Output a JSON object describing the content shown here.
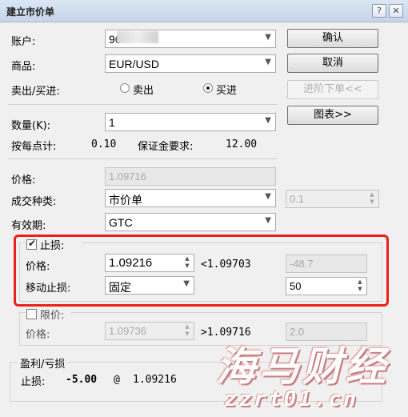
{
  "window": {
    "title": "建立市价单",
    "help": "?",
    "close": "✕"
  },
  "account": {
    "label": "账户:",
    "value": "96"
  },
  "symbol": {
    "label": "商品:",
    "value": "EUR/USD"
  },
  "side": {
    "label": "卖出/买进:",
    "sell": "卖出",
    "buy": "买进",
    "selected": "buy"
  },
  "quantity": {
    "label": "数量(K):",
    "value": "1"
  },
  "pip_info": {
    "per_pip_label": "按每点计:",
    "per_pip_value": "0.10",
    "margin_label": "保证金要求:",
    "margin_value": "12.00"
  },
  "price": {
    "label": "价格:",
    "value": "1.09716"
  },
  "exec_type": {
    "label": "成交种类:",
    "value": "市价单",
    "range": "0.1"
  },
  "validity": {
    "label": "有效期:",
    "value": "GTC"
  },
  "stop": {
    "checkbox_label": "止损:",
    "checked": true,
    "price_label": "价格:",
    "price_value": "1.09216",
    "compare": "<1.09703",
    "pips": "-48.7",
    "trailing_label": "移动止损:",
    "trailing_value": "固定",
    "trailing_step": "50"
  },
  "limit": {
    "checkbox_label": "限价:",
    "checked": false,
    "price_label": "价格:",
    "price_value": "1.09736",
    "compare": ">1.09716",
    "pips": "2.0"
  },
  "pnl": {
    "group_label": "盈利/亏损",
    "stop_label": "止损:",
    "stop_amount": "-5.00",
    "at": "@",
    "stop_price": "1.09216"
  },
  "buttons": {
    "confirm": "确认",
    "cancel": "取消",
    "advanced": "进阶下单<<",
    "chart": "图表>>"
  },
  "watermark": {
    "line1": "海马财经",
    "line2": "zzrt01.cn"
  }
}
